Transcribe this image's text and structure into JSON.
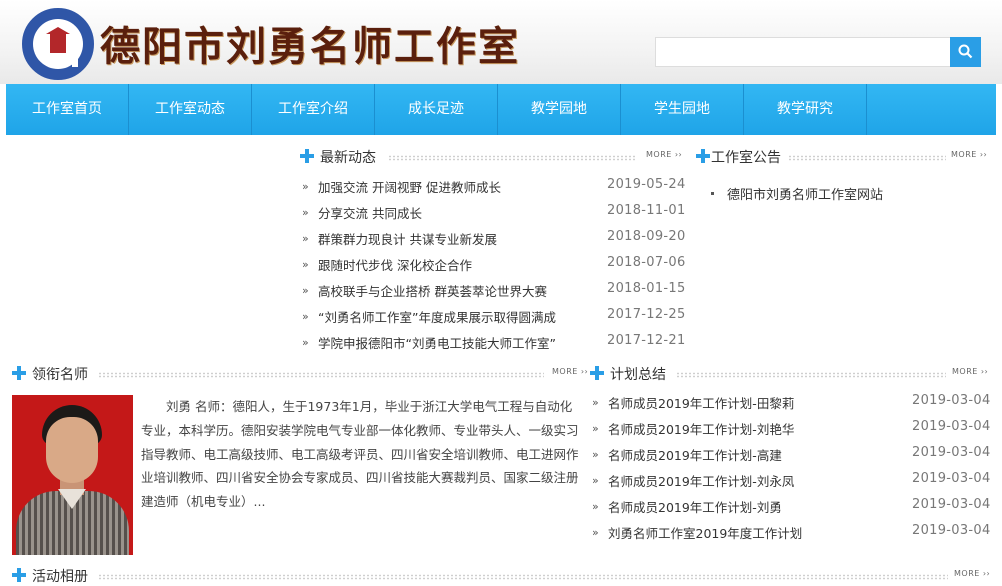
{
  "header": {
    "title": "德阳市刘勇名师工作室",
    "logo": "德阳市刘勇名师工作室-seal",
    "search": {
      "value": "",
      "placeholder": ""
    }
  },
  "nav": {
    "items": [
      "工作室首页",
      "工作室动态",
      "工作室介绍",
      "成长足迹",
      "教学园地",
      "学生园地",
      "教学研究"
    ]
  },
  "more_label": "MORE",
  "news": {
    "title": "最新动态",
    "items": [
      {
        "text": "加强交流  开阔视野  促进教师成长",
        "date": "2019-05-24"
      },
      {
        "text": "分享交流  共同成长",
        "date": "2018-11-01"
      },
      {
        "text": "群策群力现良计  共谋专业新发展",
        "date": "2018-09-20"
      },
      {
        "text": "跟随时代步伐  深化校企合作",
        "date": "2018-07-06"
      },
      {
        "text": "高校联手与企业搭桥  群英荟萃论世界大赛",
        "date": "2018-01-15"
      },
      {
        "text": "“刘勇名师工作室”年度成果展示取得圆满成",
        "date": "2017-12-25"
      },
      {
        "text": "学院申报德阳市“刘勇电工技能大师工作室”",
        "date": "2017-12-21"
      }
    ]
  },
  "notice": {
    "title": "工作室公告",
    "items": [
      "德阳市刘勇名师工作室网站"
    ]
  },
  "teacher": {
    "title": "领衔名师",
    "bio": "刘勇  名师：德阳人，生于1973年1月，毕业于浙江大学电气工程与自动化专业，本科学历。德阳安装学院电气专业部一体化教师、专业带头人、一级实习指导教师、电工高级技师、电工高级考评员、四川省安全培训教师、电工进网作业培训教师、四川省安全协会专家成员、四川省技能大赛裁判员、国家二级注册建造师（机电专业）..."
  },
  "plans": {
    "title": "计划总结",
    "items": [
      {
        "text": "名师成员2019年工作计划-田黎莉",
        "date": "2019-03-04"
      },
      {
        "text": "名师成员2019年工作计划-刘艳华",
        "date": "2019-03-04"
      },
      {
        "text": "名师成员2019年工作计划-高建",
        "date": "2019-03-04"
      },
      {
        "text": "名师成员2019年工作计划-刘永凤",
        "date": "2019-03-04"
      },
      {
        "text": "名师成员2019年工作计划-刘勇",
        "date": "2019-03-04"
      },
      {
        "text": "刘勇名师工作室2019年度工作计划",
        "date": "2019-03-04"
      }
    ]
  },
  "album": {
    "title": "活动相册"
  },
  "colors": {
    "accent": "#2a9ee6",
    "nav": "#22a6ec",
    "title": "#5a1f0d"
  }
}
